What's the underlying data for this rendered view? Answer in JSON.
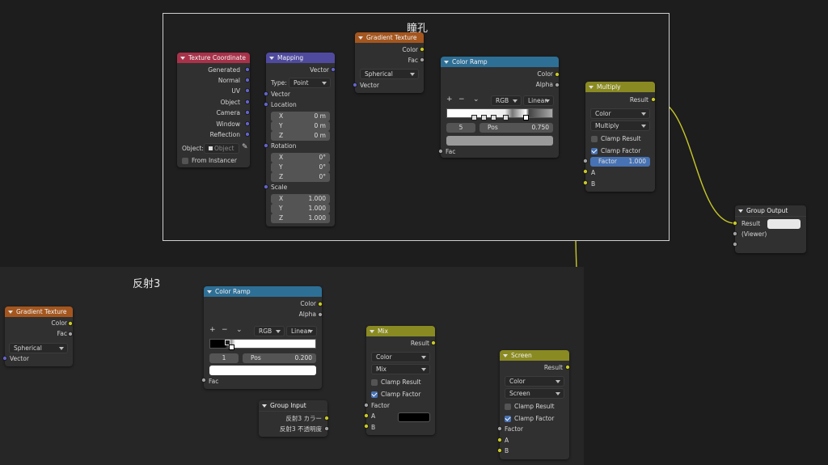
{
  "frames": {
    "pupil": {
      "label": "瞳孔"
    },
    "reflection": {
      "label": "反射3"
    }
  },
  "nodes": {
    "texture_coordinate": {
      "title": "Texture Coordinate",
      "outputs": [
        "Generated",
        "Normal",
        "UV",
        "Object",
        "Camera",
        "Window",
        "Reflection"
      ],
      "object_label": "Object:",
      "object_placeholder": "Object",
      "from_instancer": "From Instancer"
    },
    "mapping": {
      "title": "Mapping",
      "output": "Vector",
      "type_label": "Type:",
      "type_value": "Point",
      "vector_label": "Vector",
      "location_label": "Location",
      "location": [
        {
          "axis": "X",
          "value": "0 m"
        },
        {
          "axis": "Y",
          "value": "0 m"
        },
        {
          "axis": "Z",
          "value": "0 m"
        }
      ],
      "rotation_label": "Rotation",
      "rotation": [
        {
          "axis": "X",
          "value": "0°"
        },
        {
          "axis": "Y",
          "value": "0°"
        },
        {
          "axis": "Z",
          "value": "0°"
        }
      ],
      "scale_label": "Scale",
      "scale": [
        {
          "axis": "X",
          "value": "1.000"
        },
        {
          "axis": "Y",
          "value": "1.000"
        },
        {
          "axis": "Z",
          "value": "1.000"
        }
      ]
    },
    "gradient_texture_1": {
      "title": "Gradient Texture",
      "outputs": [
        "Color",
        "Fac"
      ],
      "type": "Spherical",
      "input": "Vector"
    },
    "color_ramp_1": {
      "title": "Color Ramp",
      "outputs": [
        "Color",
        "Alpha"
      ],
      "plus": "+",
      "minus": "−",
      "mode": "RGB",
      "interpolation": "Linear",
      "index": "5",
      "pos_label": "Pos",
      "pos_value": "0.750",
      "input": "Fac"
    },
    "multiply": {
      "title": "Multiply",
      "output": "Result",
      "data_type": "Color",
      "blend": "Multiply",
      "clamp_result": "Clamp Result",
      "clamp_factor": "Clamp Factor",
      "factor_label": "Factor",
      "factor_value": "1.000",
      "input_a": "A",
      "input_b": "B"
    },
    "group_output": {
      "title": "Group Output",
      "inputs": [
        "Result",
        "(Viewer)"
      ],
      "result_color": "#e8e8e8"
    },
    "gradient_texture_2": {
      "title": "Gradient Texture",
      "outputs": [
        "Color",
        "Fac"
      ],
      "type": "Spherical",
      "input": "Vector"
    },
    "color_ramp_2": {
      "title": "Color Ramp",
      "outputs": [
        "Color",
        "Alpha"
      ],
      "plus": "+",
      "minus": "−",
      "mode": "RGB",
      "interpolation": "Linear",
      "index": "1",
      "pos_label": "Pos",
      "pos_value": "0.200",
      "input": "Fac"
    },
    "mix": {
      "title": "Mix",
      "output": "Result",
      "data_type": "Color",
      "blend": "Mix",
      "clamp_result": "Clamp Result",
      "clamp_factor": "Clamp Factor",
      "factor_label": "Factor",
      "input_a": "A",
      "input_b": "B",
      "b_color": "#000000"
    },
    "group_input": {
      "title": "Group Input",
      "outputs": [
        "反射3 カラー",
        "反射3 不透明度"
      ]
    },
    "screen": {
      "title": "Screen",
      "output": "Result",
      "data_type": "Color",
      "blend": "Screen",
      "clamp_result": "Clamp Result",
      "clamp_factor": "Clamp Factor",
      "factor_label": "Factor",
      "input_a": "A",
      "input_b": "B"
    }
  },
  "colors": {
    "header_input": "#a8324a",
    "header_vector": "#4f4a9e",
    "header_texture": "#a4561e",
    "header_converter": "#2e6f96",
    "header_color": "#8a8a22",
    "header_group": "#303030",
    "socket_vector": "#6363c7",
    "socket_color": "#c7c729",
    "socket_float": "#a1a1a1",
    "link_color": "#c7c729",
    "link_float": "#a1a1a1",
    "link_vector": "#6363c7"
  }
}
